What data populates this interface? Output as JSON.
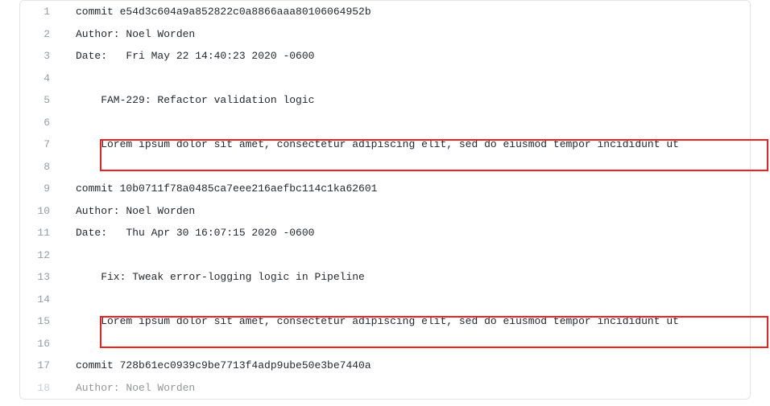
{
  "lines": [
    {
      "n": 1,
      "text": "commit e54d3c604a9a852822c0a8866aaa80106064952b"
    },
    {
      "n": 2,
      "text": "Author: Noel Worden"
    },
    {
      "n": 3,
      "text": "Date:   Fri May 22 14:40:23 2020 -0600"
    },
    {
      "n": 4,
      "text": ""
    },
    {
      "n": 5,
      "text": "    FAM-229: Refactor validation logic"
    },
    {
      "n": 6,
      "text": ""
    },
    {
      "n": 7,
      "text": "    Lorem ipsum dolor sit amet, consectetur adipiscing elit, sed do eiusmod tempor incididunt ut"
    },
    {
      "n": 8,
      "text": ""
    },
    {
      "n": 9,
      "text": "commit 10b0711f78a0485ca7eee216aefbc114c1ka62601"
    },
    {
      "n": 10,
      "text": "Author: Noel Worden"
    },
    {
      "n": 11,
      "text": "Date:   Thu Apr 30 16:07:15 2020 -0600"
    },
    {
      "n": 12,
      "text": ""
    },
    {
      "n": 13,
      "text": "    Fix: Tweak error-logging logic in Pipeline"
    },
    {
      "n": 14,
      "text": ""
    },
    {
      "n": 15,
      "text": "    Lorem ipsum dolor sit amet, consectetur adipiscing elit, sed do eiusmod tempor incididunt ut"
    },
    {
      "n": 16,
      "text": ""
    },
    {
      "n": 17,
      "text": "commit 728b61ec0939c9be7713f4adp9ube50e3be7440a"
    },
    {
      "n": 18,
      "text": "Author: Noel Worden"
    }
  ],
  "highlights": [
    {
      "line": 7
    },
    {
      "line": 15
    }
  ]
}
